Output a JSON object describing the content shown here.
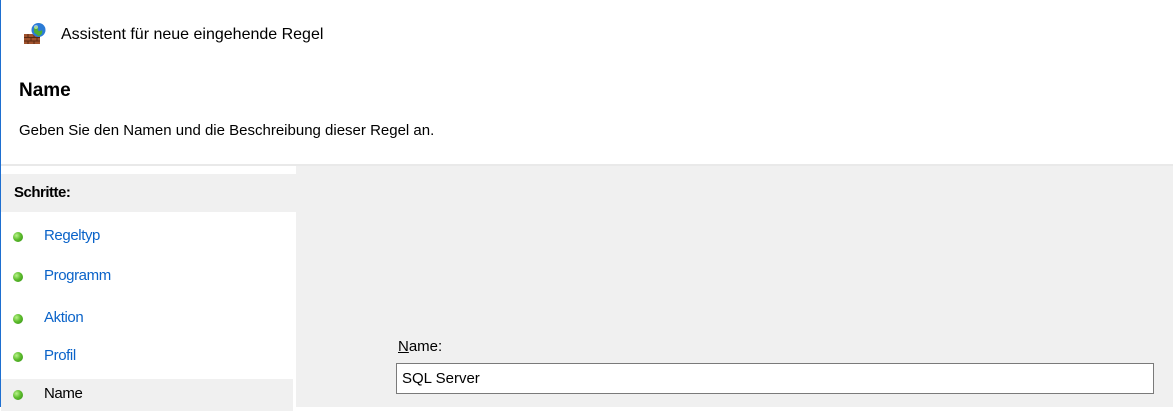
{
  "window": {
    "title": "Assistent für neue eingehende Regel",
    "icon": "firewall-icon"
  },
  "header": {
    "title": "Name",
    "subtitle": "Geben Sie den Namen und die Beschreibung dieser Regel an."
  },
  "steps": {
    "heading": "Schritte:",
    "items": [
      {
        "label": "Regeltyp",
        "active": false
      },
      {
        "label": "Programm",
        "active": false
      },
      {
        "label": "Aktion",
        "active": false
      },
      {
        "label": "Profil",
        "active": false
      },
      {
        "label": "Name",
        "active": true
      }
    ]
  },
  "form": {
    "name_label_mnemonic": "N",
    "name_label_rest": "ame:",
    "name_value": "SQL Server"
  },
  "colors": {
    "link": "#0a63c9",
    "panel_bg": "#f0f0f0",
    "window_border": "#1e6fd0",
    "status_dot": "#5fbe2e"
  }
}
